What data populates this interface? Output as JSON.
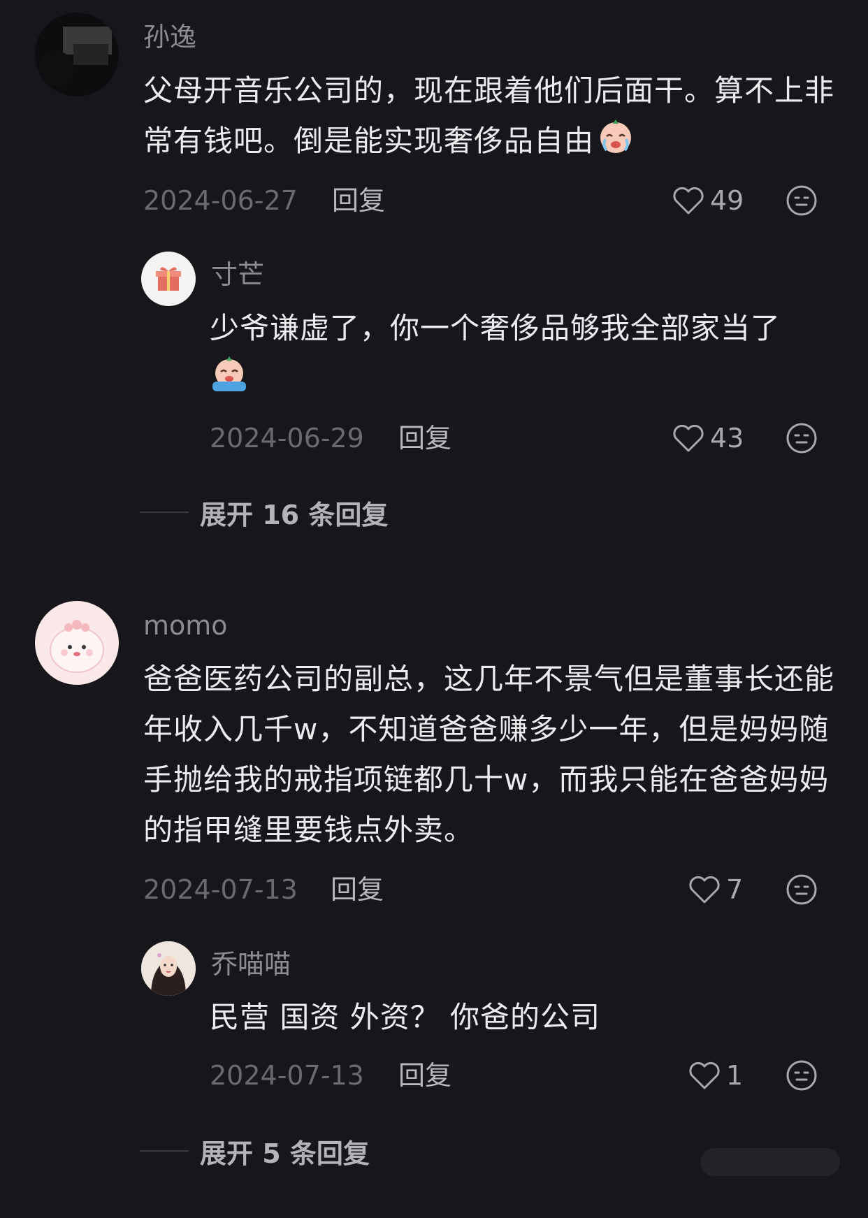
{
  "comments": [
    {
      "username": "孙逸",
      "text": "父母开音乐公司的，现在跟着他们后面干。算不上非常有钱吧。倒是能实现奢侈品自由",
      "emoji": "crying-face-emoji",
      "date": "2024-06-27",
      "reply_label": "回复",
      "likes": "49",
      "replies": [
        {
          "username": "寸芒",
          "text": "少爷谦虚了，你一个奢侈品够我全部家当了",
          "emoji": "crying-face-emoji",
          "date": "2024-06-29",
          "reply_label": "回复",
          "likes": "43"
        }
      ],
      "expand_label": "展开 16 条回复"
    },
    {
      "username": "momo",
      "text": "爸爸医药公司的副总，这几年不景气但是董事长还能年收入几千w，不知道爸爸赚多少一年，但是妈妈随手抛给我的戒指项链都几十w，而我只能在爸爸妈妈的指甲缝里要钱点外卖。",
      "date": "2024-07-13",
      "reply_label": "回复",
      "likes": "7",
      "replies": [
        {
          "username": "乔喵喵",
          "text": "民营 国资 外资？ 你爸的公司",
          "date": "2024-07-13",
          "reply_label": "回复",
          "likes": "1"
        }
      ],
      "expand_label": "展开 5 条回复"
    }
  ],
  "icons": {
    "like": "heart-outline-icon",
    "react": "smiley-face-icon"
  },
  "colors": {
    "background": "#17161b",
    "text": "#ececee",
    "username": "#8c8b91",
    "date": "#6b6a70"
  }
}
